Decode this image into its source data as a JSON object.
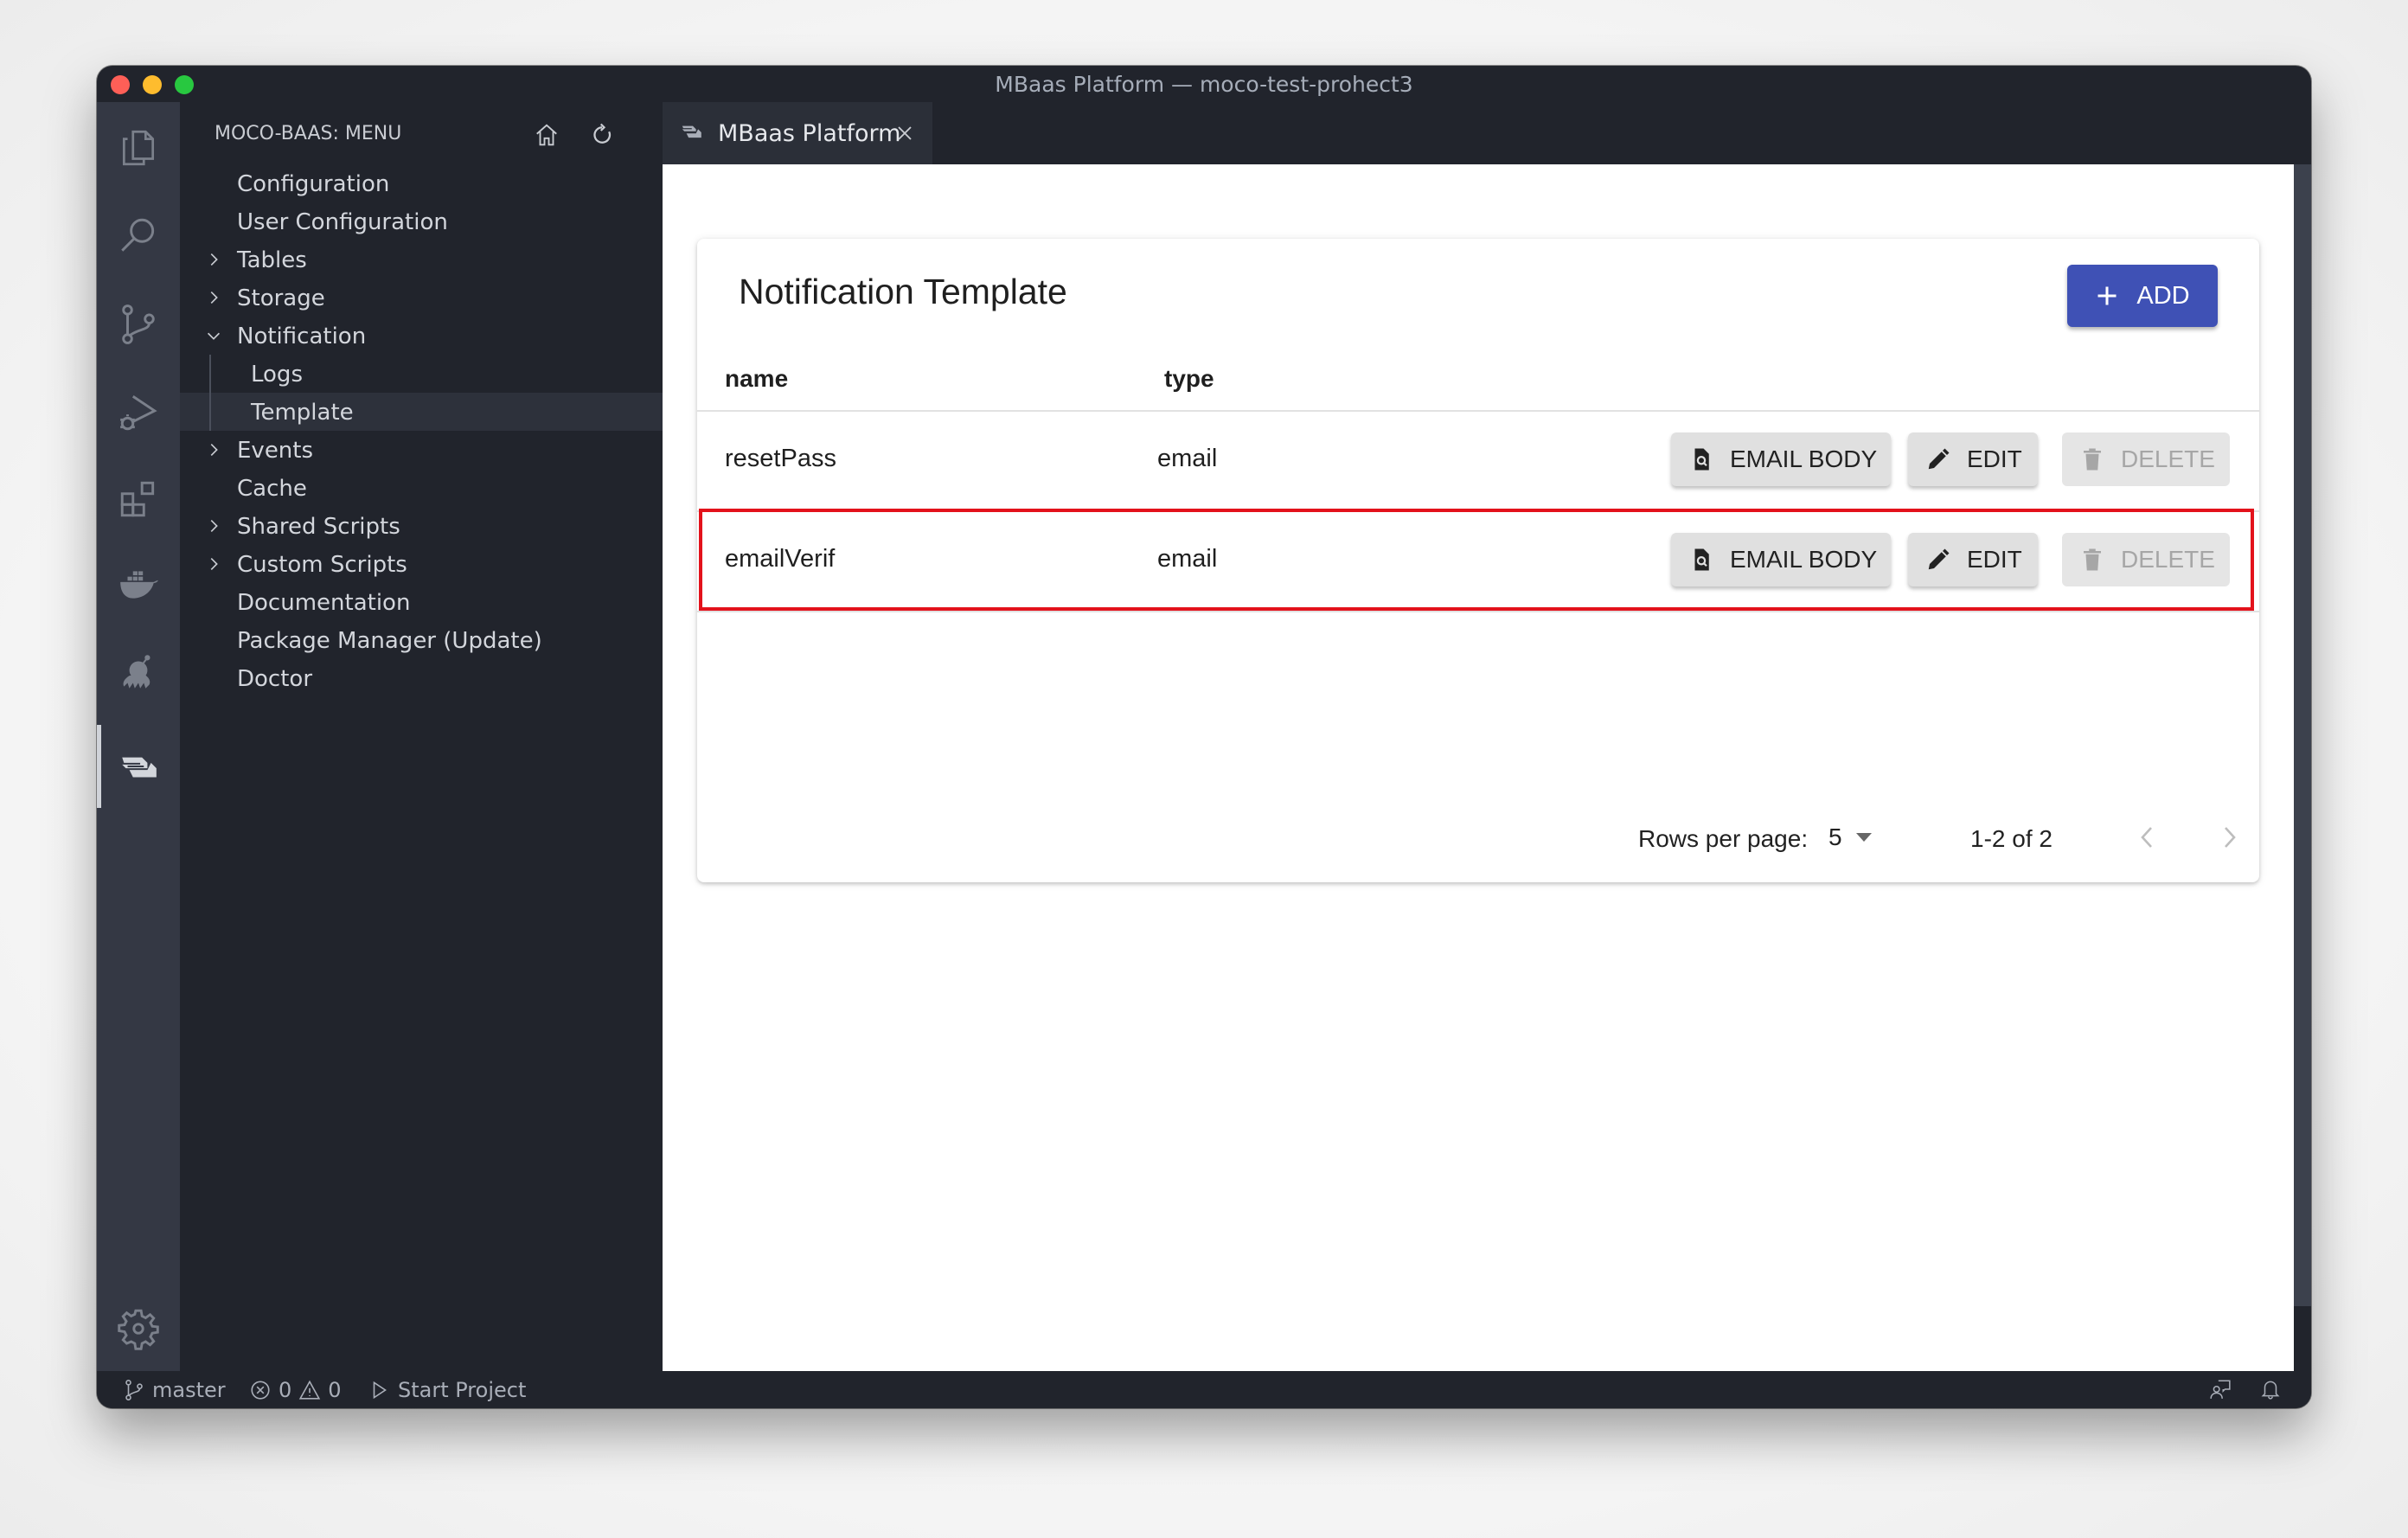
{
  "window": {
    "title": "MBaas Platform — moco-test-prohect3"
  },
  "activity_bar": {
    "items": [
      {
        "name": "explorer-icon"
      },
      {
        "name": "search-icon"
      },
      {
        "name": "source-control-icon"
      },
      {
        "name": "run-debug-icon"
      },
      {
        "name": "extensions-icon"
      },
      {
        "name": "docker-icon"
      },
      {
        "name": "octopus-icon"
      },
      {
        "name": "mbaas-icon",
        "active": true
      }
    ],
    "bottom": {
      "name": "settings-gear-icon"
    }
  },
  "sidebar": {
    "title": "MOCO-BAAS: MENU",
    "actions": [
      "home-icon",
      "refresh-icon"
    ],
    "items": [
      {
        "label": "Configuration",
        "chevron": "none"
      },
      {
        "label": "User Configuration",
        "chevron": "none"
      },
      {
        "label": "Tables",
        "chevron": "right"
      },
      {
        "label": "Storage",
        "chevron": "right"
      },
      {
        "label": "Notification",
        "chevron": "down"
      },
      {
        "label": "Logs",
        "chevron": "none",
        "child": true
      },
      {
        "label": "Template",
        "chevron": "none",
        "child": true,
        "selected": true
      },
      {
        "label": "Events",
        "chevron": "right"
      },
      {
        "label": "Cache",
        "chevron": "none"
      },
      {
        "label": "Shared Scripts",
        "chevron": "right"
      },
      {
        "label": "Custom Scripts",
        "chevron": "right"
      },
      {
        "label": "Documentation",
        "chevron": "none"
      },
      {
        "label": "Package Manager (Update)",
        "chevron": "none"
      },
      {
        "label": "Doctor",
        "chevron": "none"
      }
    ]
  },
  "tabs": [
    {
      "label": "MBaas Platform",
      "active": true
    }
  ],
  "tab_actions": [
    "git-compare-icon",
    "split-editor-icon",
    "more-actions-icon"
  ],
  "main": {
    "card_title": "Notification Template",
    "add_label": "ADD",
    "columns": [
      "name",
      "type"
    ],
    "rows": [
      {
        "name": "resetPass",
        "type": "email",
        "highlighted": false
      },
      {
        "name": "emailVerif",
        "type": "email",
        "highlighted": true
      }
    ],
    "row_actions": {
      "email_body": "EMAIL BODY",
      "edit": "EDIT",
      "delete": "DELETE",
      "delete_disabled": true
    },
    "pagination": {
      "rows_per_page_label": "Rows per page:",
      "rows_per_page_value": "5",
      "range": "1-2 of 2",
      "prev_disabled": true,
      "next_disabled": true
    },
    "accent_color": "#3f51b5",
    "highlight_color": "#e3121b"
  },
  "status_bar": {
    "branch": "master",
    "errors": "0",
    "warnings": "0",
    "run_label": "Start Project"
  }
}
